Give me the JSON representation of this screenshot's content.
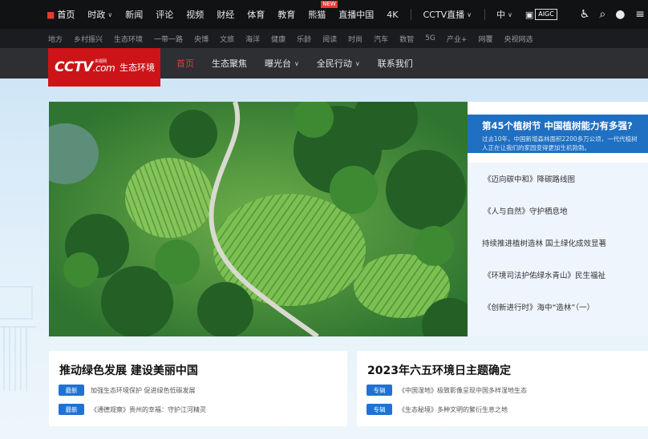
{
  "topnav": {
    "items": [
      {
        "label": "首页",
        "icon": "home-icon"
      },
      {
        "label": "时政",
        "dropdown": true
      },
      {
        "label": "新闻"
      },
      {
        "label": "评论"
      },
      {
        "label": "视频"
      },
      {
        "label": "财经"
      },
      {
        "label": "体育"
      },
      {
        "label": "教育"
      },
      {
        "label": "熊猫",
        "badge": "NEW"
      },
      {
        "label": "直播中国"
      },
      {
        "label": "4K"
      },
      {
        "label": "CCTV直播",
        "dropdown": true
      },
      {
        "label": "中",
        "dropdown": true
      }
    ],
    "aigc_label": "AIGC",
    "tools": [
      "accessibility-icon",
      "search-icon",
      "user-icon",
      "menu-icon"
    ]
  },
  "subnav": {
    "items": [
      "地方",
      "乡村振兴",
      "生态环境",
      "一带一路",
      "央博",
      "文旅",
      "海洋",
      "健康",
      "乐龄",
      "阅读",
      "时尚",
      "汽车",
      "数智",
      "5G",
      "产业+",
      "网覆",
      "央视网选"
    ]
  },
  "logo": {
    "brand": "CCTV",
    "domain": ".com",
    "tiny": "央视网",
    "channel": "生态环境"
  },
  "channel_nav": {
    "items": [
      {
        "label": "首页",
        "active": true
      },
      {
        "label": "生态聚焦"
      },
      {
        "label": "曝光台",
        "dropdown": true
      },
      {
        "label": "全民行动",
        "dropdown": true
      },
      {
        "label": "联系我们"
      }
    ]
  },
  "feature": {
    "title": "第45个植树节 中国植树能力有多强?",
    "desc": "过去10年，中国新增森林面积2200多万公顷，一代代植树人正在让我们的家园变得更加生机勃勃。",
    "links": [
      "《迈向碳中和》降碳路线图",
      "《人与自然》守护栖息地",
      "持续推进植树造林 国土绿化成效显著",
      "《环境司法护佑绿水青山》民生福祉",
      "《创新进行时》海中“造林”（一）"
    ]
  },
  "cards": [
    {
      "title": "推动绿色发展 建设美丽中国",
      "rows": [
        {
          "tag": "最新",
          "text": "加强生态环境保护 促进绿色低碳发展"
        },
        {
          "tag": "最新",
          "text": "《通德观察》贵州的幸福：守护江河精灵"
        }
      ]
    },
    {
      "title": "2023年六五环境日主题确定",
      "rows": [
        {
          "tag": "专辑",
          "text": "《中国湿地》极致影像呈现中国多样湿地生态"
        },
        {
          "tag": "专辑",
          "text": "《生态秘境》多种文明的繁衍生息之地"
        }
      ]
    }
  ],
  "colors": {
    "topbar": "#111214",
    "brand_red": "#cc1418",
    "feature_blue": "#1f6fc3",
    "tag_blue": "#1f72d4"
  }
}
